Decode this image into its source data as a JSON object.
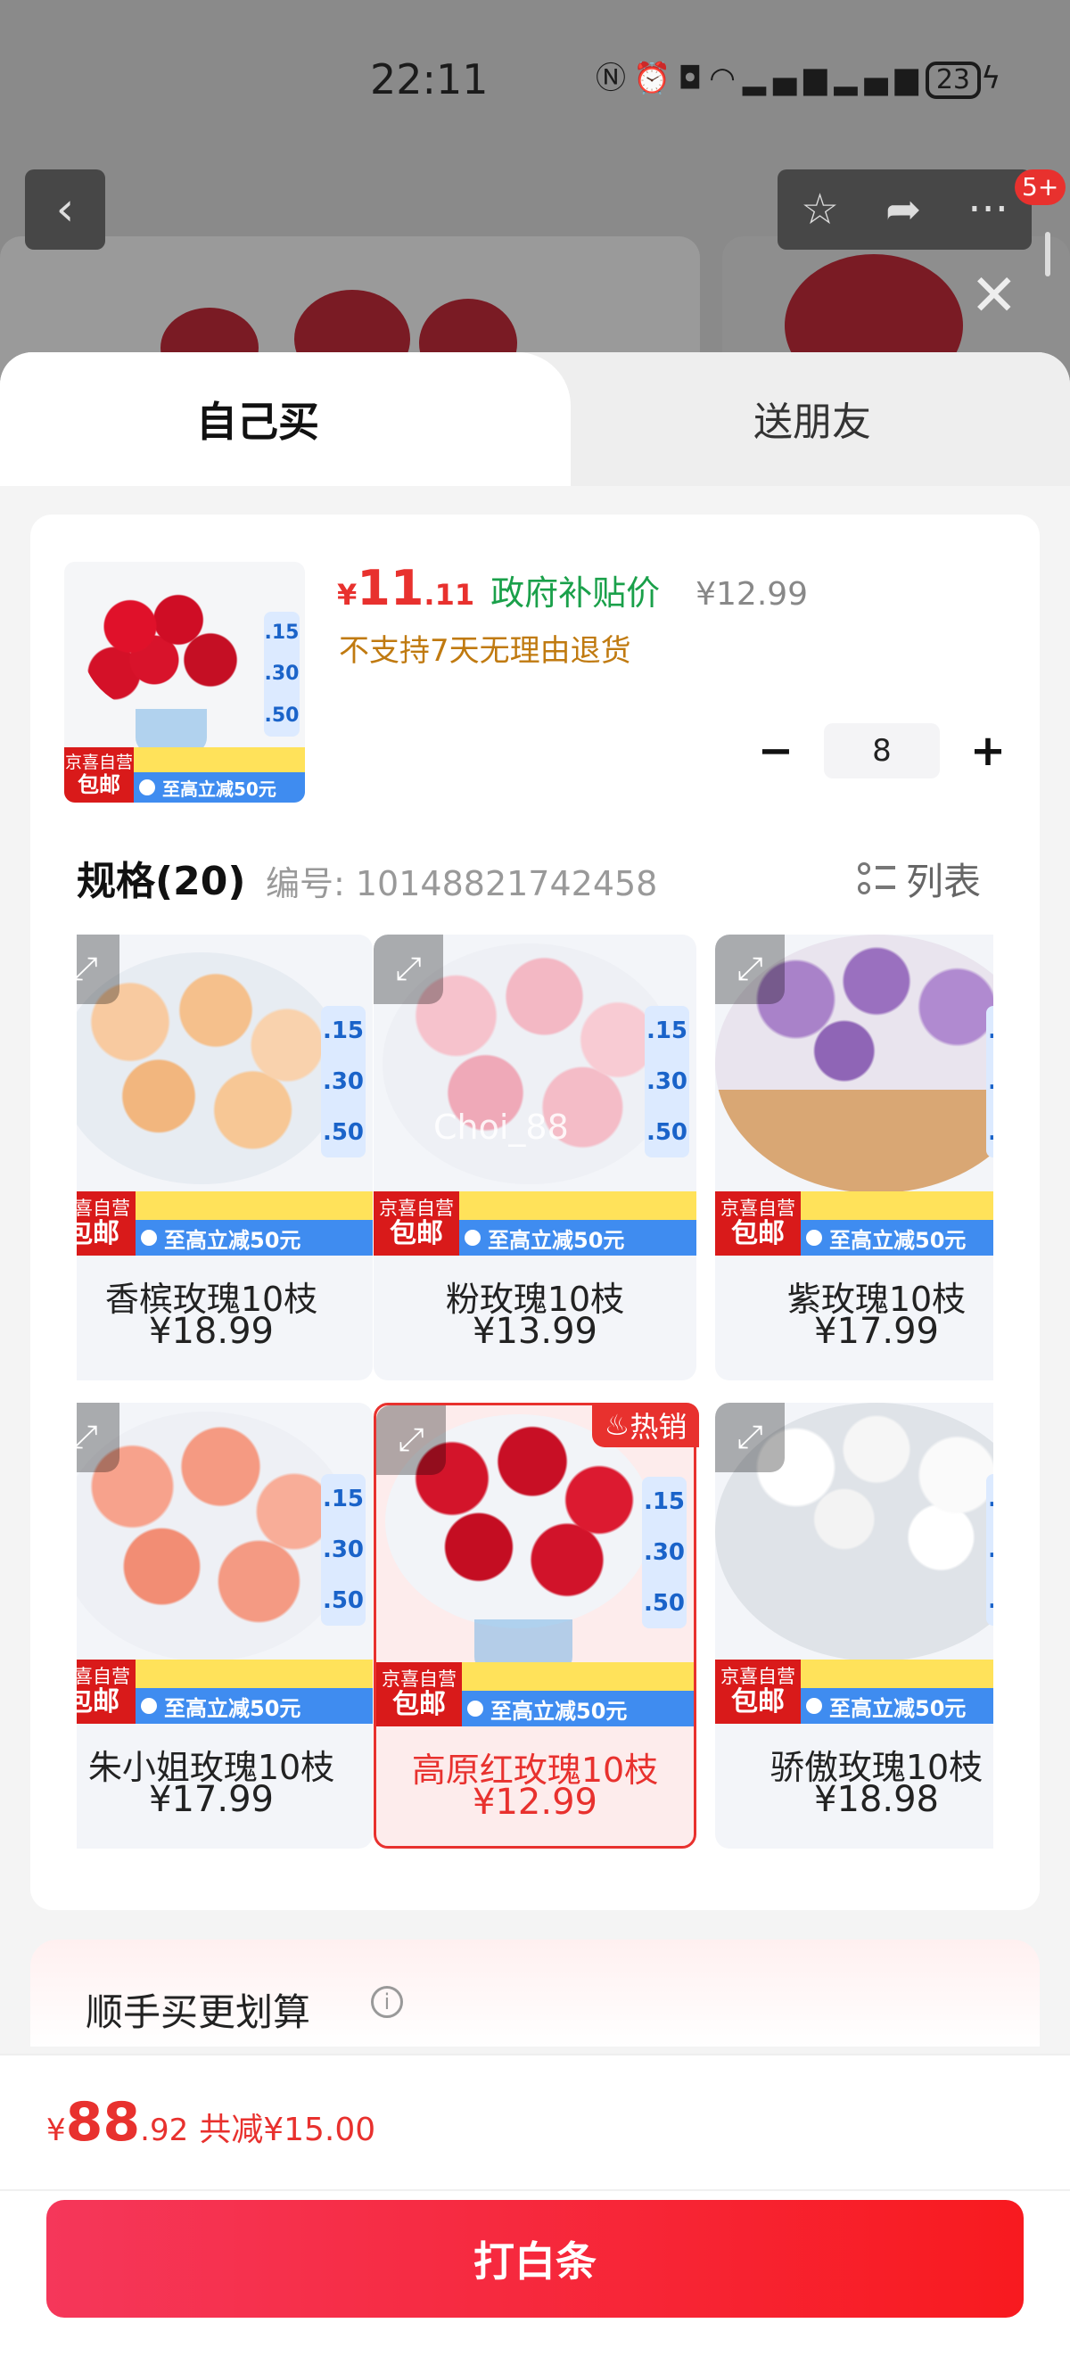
{
  "status_bar": {
    "time": "22:11",
    "icons": [
      "nfc-icon",
      "alarm-icon",
      "camera-icon",
      "wifi-icon",
      "4g-signal-icon",
      "5g-signal-icon"
    ],
    "battery": "23"
  },
  "top_nav": {
    "cart_badge": "5+"
  },
  "tabs": {
    "self_buy": "自己买",
    "gift": "送朋友"
  },
  "product": {
    "price_currency": "¥",
    "price_int": "11",
    "price_dec": ".11",
    "subsidy_label": "政府补贴价",
    "original_price": "¥12.99",
    "return_policy": "不支持7天无理由退货",
    "quantity": "8",
    "thumb_badge_line1": "京喜自营",
    "thumb_badge_line2": "包邮",
    "thumb_promo": "至高立减50元"
  },
  "spec": {
    "title": "规格(20)",
    "code": "编号: 10148821742458",
    "list_label": "列表"
  },
  "variants": [
    {
      "name": "香槟玫瑰10枝",
      "price": "¥18.99",
      "jd_line1": "京喜自营",
      "jd_line2": "包邮",
      "promo": "至高立减50元",
      "color": "#f6c48e"
    },
    {
      "name": "粉玫瑰10枝",
      "price": "¥13.99",
      "jd_line1": "京喜自营",
      "jd_line2": "包邮",
      "promo": "至高立减50元",
      "color": "#f3b8c4"
    },
    {
      "name": "紫玫瑰10枝",
      "price": "¥17.99",
      "jd_line1": "京喜自营",
      "jd_line2": "包邮",
      "promo": "至高立减50元",
      "color": "#a27bc4"
    },
    {
      "name": "朱小姐玫瑰10枝",
      "price": "¥17.99",
      "jd_line1": "京喜自营",
      "jd_line2": "包邮",
      "promo": "至高立减50元",
      "color": "#f59a82"
    },
    {
      "name": "高原红玫瑰10枝",
      "price": "¥12.99",
      "jd_line1": "京喜自营",
      "jd_line2": "包邮",
      "promo": "至高立减50元",
      "color": "#d3142a",
      "hot": "热销"
    },
    {
      "name": "骄傲玫瑰10枝",
      "price": "¥18.98",
      "jd_line1": "京喜自营",
      "jd_line2": "包邮",
      "promo": "至高立减50元",
      "color": "#f4f4f4"
    }
  ],
  "side_promo": [
    ".15",
    ".30",
    ".50"
  ],
  "watermark": "Choi_88",
  "addon": {
    "title": "顺手买更划算"
  },
  "footer": {
    "total_currency": "¥",
    "total_int": "88",
    "total_dec": ".92",
    "savings": "共减¥15.00",
    "buy_label": "打白条"
  },
  "colors": {
    "accent_red": "#e8312e",
    "subsidy_green": "#1aa04a",
    "warning_orange": "#c07a10"
  }
}
